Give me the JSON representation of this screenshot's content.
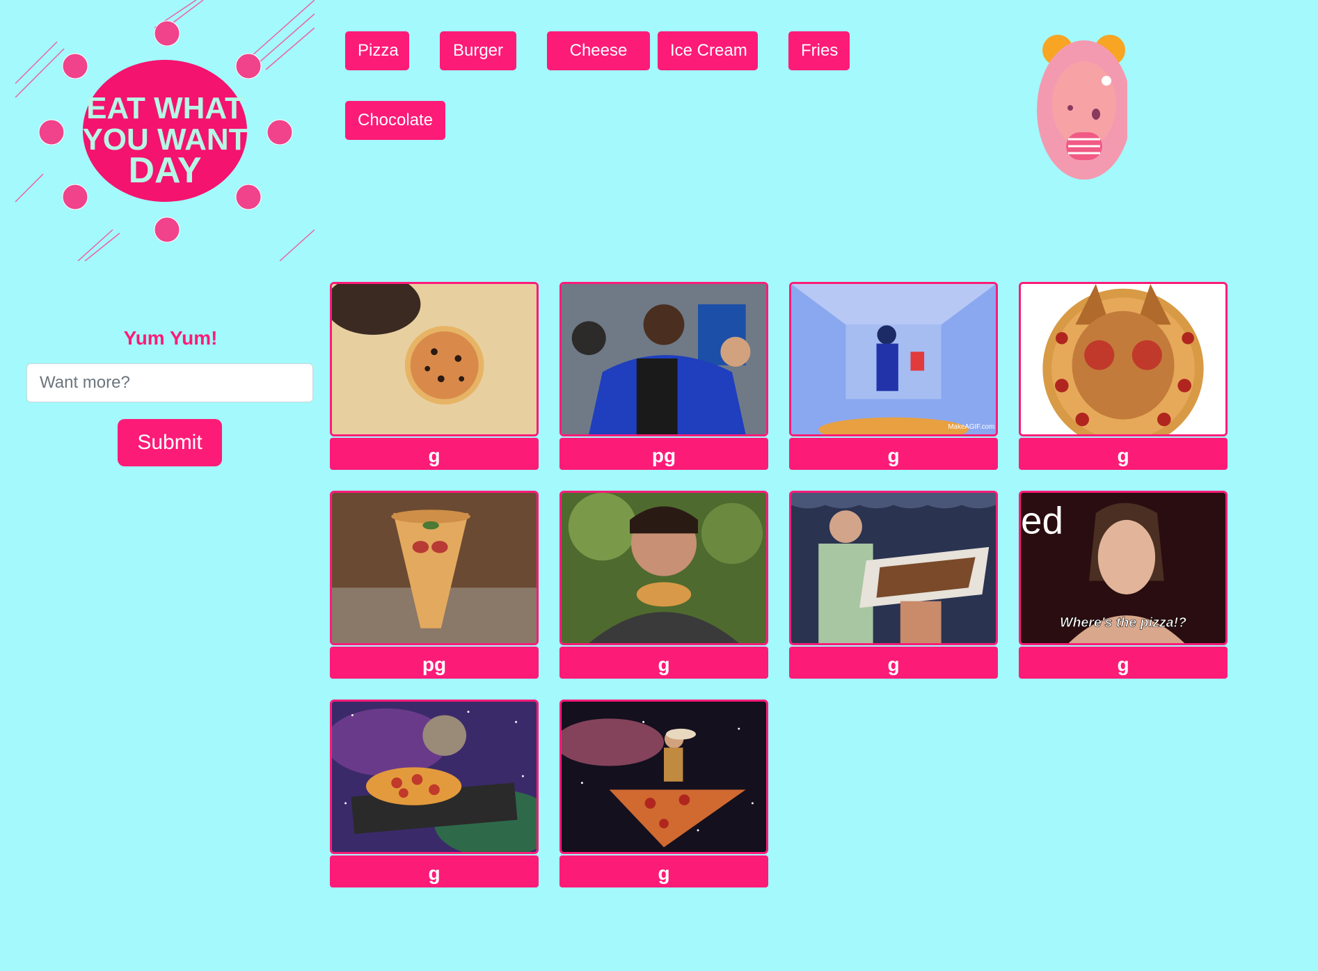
{
  "logo": {
    "text_line1": "EAT WHAT",
    "text_line2": "YOU WANT",
    "text_line3": "DAY"
  },
  "nav": {
    "buttons": [
      {
        "label": "Pizza"
      },
      {
        "label": "Burger"
      },
      {
        "label": "Cheese"
      },
      {
        "label": "Ice Cream"
      },
      {
        "label": "Fries"
      },
      {
        "label": "Chocolate"
      }
    ]
  },
  "form": {
    "title": "Yum Yum!",
    "input_placeholder": "Want more?",
    "submit_label": "Submit"
  },
  "gifs": [
    {
      "rating": "g",
      "scene": "pizza-on-cheese"
    },
    {
      "rating": "pg",
      "scene": "man-in-blue-jacket"
    },
    {
      "rating": "g",
      "scene": "man-dancing-over-pizza",
      "watermark": "MakeAGIF.com"
    },
    {
      "rating": "g",
      "scene": "cat-with-pepperoni-eyes"
    },
    {
      "rating": "pg",
      "scene": "dancing-pizza-slice"
    },
    {
      "rating": "g",
      "scene": "man-eating-pizza"
    },
    {
      "rating": "g",
      "scene": "boy-holding-pizza-box"
    },
    {
      "rating": "g",
      "scene": "woman-wheres-the-pizza",
      "caption": "Where's the pizza!?",
      "corner_text": "ed"
    },
    {
      "rating": "g",
      "scene": "cat-dj-pizza-turntable"
    },
    {
      "rating": "g",
      "scene": "cowboy-riding-pizza-in-space"
    }
  ],
  "colors": {
    "background": "#a3f9fb",
    "accent": "#fd1b78",
    "logo_text": "#b6f7e6"
  }
}
